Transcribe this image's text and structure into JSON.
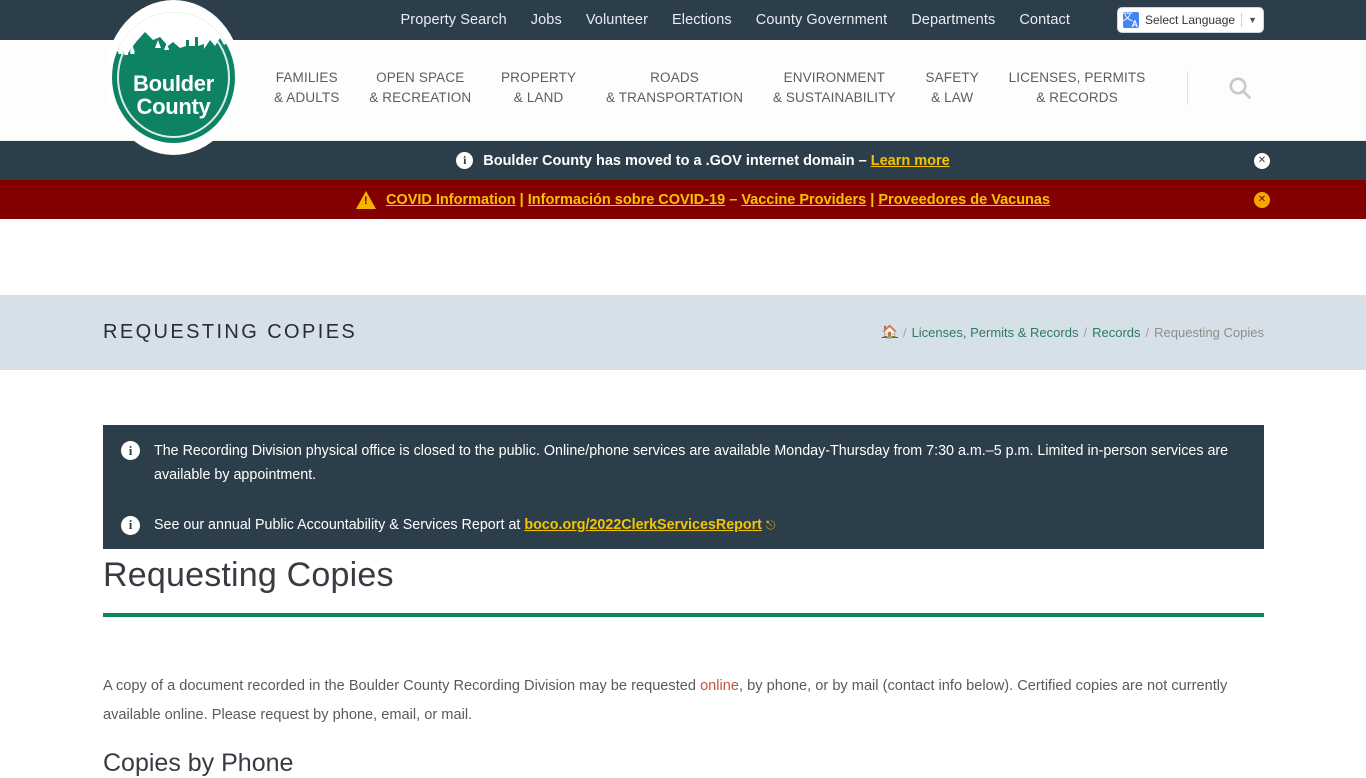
{
  "topbar": {
    "links": [
      {
        "label": "Property Search",
        "name": "property-search"
      },
      {
        "label": "Jobs",
        "name": "jobs"
      },
      {
        "label": "Volunteer",
        "name": "volunteer"
      },
      {
        "label": "Elections",
        "name": "elections"
      },
      {
        "label": "County Government",
        "name": "county-government"
      },
      {
        "label": "Departments",
        "name": "departments"
      },
      {
        "label": "Contact",
        "name": "contact"
      }
    ],
    "language_selector": {
      "label": "Select Language",
      "caret": "▼",
      "icon": "translate-icon"
    }
  },
  "logo": {
    "line1": "Boulder",
    "line2": "County",
    "color": "#0e8364"
  },
  "mainnav": {
    "items": [
      {
        "line1": "FAMILIES",
        "line2": "& ADULTS"
      },
      {
        "line1": "OPEN SPACE",
        "line2": "& RECREATION"
      },
      {
        "line1": "PROPERTY",
        "line2": "& LAND"
      },
      {
        "line1": "ROADS",
        "line2": "& TRANSPORTATION"
      },
      {
        "line1": "ENVIRONMENT",
        "line2": "& SUSTAINABILITY"
      },
      {
        "line1": "SAFETY",
        "line2": "& LAW"
      },
      {
        "line1": "LICENSES, PERMITS",
        "line2": "& RECORDS"
      }
    ],
    "search_icon": "search-icon"
  },
  "alerts": {
    "gov": {
      "text": "Boulder County has moved to a .GOV internet domain – ",
      "link": "Learn more",
      "close": "✕",
      "background": "#2c3e4a"
    },
    "covid": {
      "link1": "COVID Information",
      "sep1": " | ",
      "link2": "Información sobre COVID-19",
      "sep2": " – ",
      "link3": "Vaccine Providers",
      "sep3": " | ",
      "link4": "Proveedores de Vacunas",
      "close": "✕",
      "background": "#820000",
      "link_color": "#f5c400"
    }
  },
  "titlebar": {
    "title": "REQUESTING COPIES",
    "background": "#d6e0e8",
    "breadcrumb": {
      "home_icon": "⌂",
      "sep": "/",
      "items": [
        {
          "label": "Licenses, Permits & Records",
          "current": false
        },
        {
          "label": "Records",
          "current": false
        },
        {
          "label": "Requesting Copies",
          "current": true
        }
      ]
    }
  },
  "content": {
    "notice_1": {
      "icon": "info-icon",
      "text": "The Recording Division physical office is closed to the public. Online/phone services are available Monday-Thursday from 7:30 a.m.–5 p.m. Limited in-person services are available by appointment."
    },
    "notice_2": {
      "icon": "info-icon",
      "text_before": "See our annual Public Accountability & Services Report at ",
      "link": "boco.org/2022ClerkServicesReport",
      "external_icon": "↗"
    },
    "heading": "Requesting Copies",
    "rule_color": "#0e8364",
    "paragraph": {
      "part1": "A copy of a document recorded in the Boulder County Recording Division may be requested ",
      "link": "online",
      "part2": ", by phone, or by mail (contact info below). Certified copies are not currently available online. Please request by phone, email, or mail."
    },
    "sub_heading": "Copies by Phone"
  }
}
